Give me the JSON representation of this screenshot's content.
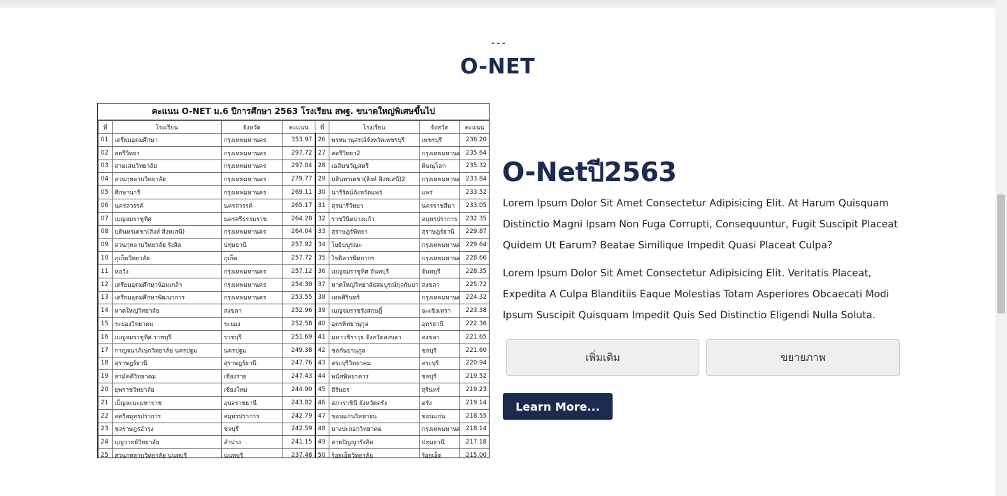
{
  "section": {
    "kicker": "---",
    "title": "O-NET"
  },
  "sheet": {
    "title": "คะแนน O-NET ม.6 ปีการศึกษา 2563 โรงเรียน สพฐ. ขนาดใหญ่พิเศษขึ้นไป",
    "headers": [
      "ที่",
      "โรงเรียน",
      "จังหวัด",
      "คะแนน",
      "ที่",
      "โรงเรียน",
      "จังหวัด",
      "คะแนน"
    ],
    "rows": [
      [
        "01",
        "เตรียมอุดมศึกษา",
        "กรุงเทพมหานคร",
        "353.97",
        "26",
        "พรหมานุสรณ์จังหวัดเพชรบุรี",
        "เพชรบุรี",
        "236.20"
      ],
      [
        "02",
        "สตรีวิทยา",
        "กรุงเทพมหานคร",
        "297.72",
        "27",
        "สตรีวิทยา2",
        "กรุงเทพมหานคร",
        "235.64"
      ],
      [
        "03",
        "สามเสนวิทยาลัย",
        "กรุงเทพมหานคร",
        "297.04",
        "28",
        "เฉลิมขวัญสตรี",
        "พิษณุโลก",
        "235.32"
      ],
      [
        "04",
        "สวนกุหลาบวิทยาลัย",
        "กรุงเทพมหานคร",
        "279.77",
        "29",
        "บดินทรเดชา(สิงห์ สิงหเสนี)2",
        "กรุงเทพมหานคร",
        "233.84"
      ],
      [
        "05",
        "ศึกษานารี",
        "กรุงเทพมหานคร",
        "269.11",
        "30",
        "นารีรัตน์จังหวัดแพร่",
        "แพร่",
        "233.52"
      ],
      [
        "06",
        "นครสวรรค์",
        "นครสวรรค์",
        "265.17",
        "31",
        "สุรนารีวิทยา",
        "นครราชสีมา",
        "233.05"
      ],
      [
        "07",
        "เบญจมราชูทิศ",
        "นครศรีธรรมราช",
        "264.28",
        "32",
        "ราชวินิตบางแก้ว",
        "สมุทรปราการ",
        "232.35"
      ],
      [
        "08",
        "บดินทรเดชา(สิงห์ สิงหเสนี)",
        "กรุงเทพมหานคร",
        "264.04",
        "33",
        "สุราษฎร์พิทยา",
        "สุราษฎร์ธานี",
        "229.87"
      ],
      [
        "09",
        "สวนกุหลาบวิทยาลัย รังสิต",
        "ปทุมธานี",
        "257.92",
        "34",
        "โยธินบูรณะ",
        "กรุงเทพมหานคร",
        "229.64"
      ],
      [
        "10",
        "ภูเก็ตวิทยาลัย",
        "ภูเก็ต",
        "257.72",
        "35",
        "โพธิสารพิทยากร",
        "กรุงเทพมหานคร",
        "228.66"
      ],
      [
        "11",
        "หอวัง",
        "กรุงเทพมหานคร",
        "257.12",
        "36",
        "เบญจมราชูทิศ จันทบุรี",
        "จันทบุรี",
        "228.35"
      ],
      [
        "12",
        "เตรียมอุดมศึกษาน้อมเกล้า",
        "กรุงเทพมหานคร",
        "254.30",
        "37",
        "หาดใหญ่วิทยาลัยสมบูรณ์กุลกันยา",
        "สงขลา",
        "225.72"
      ],
      [
        "13",
        "เตรียมอุดมศึกษาพัฒนาการ",
        "กรุงเทพมหานคร",
        "253.55",
        "38",
        "เทพศิรินทร์",
        "กรุงเทพมหานคร",
        "224.32"
      ],
      [
        "14",
        "หาดใหญ่วิทยาลัย",
        "สงขลา",
        "252.96",
        "39",
        "เบญจมราชรังสฤษฎิ์",
        "ฉะเชิงเทรา",
        "223.38"
      ],
      [
        "15",
        "ระยองวิทยาคม",
        "ระยอง",
        "252.58",
        "40",
        "อุดรพิทยานุกูล",
        "อุดรธานี",
        "222.36"
      ],
      [
        "16",
        "เบญจมราชูทิศ ราชบุรี",
        "ราชบุรี",
        "251.69",
        "41",
        "มหาวชิราวุธ จังหวัดสงขลา",
        "สงขลา",
        "221.65"
      ],
      [
        "17",
        "กาญจนาภิเษกวิทยาลัย นครปฐม",
        "นครปฐม",
        "249.38",
        "42",
        "ชลกันยานุกูล",
        "ชลบุรี",
        "221.60"
      ],
      [
        "18",
        "สุราษฎร์ธานี",
        "สุราษฎร์ธานี",
        "247.76",
        "43",
        "สระบุรีวิทยาคม",
        "สระบุรี",
        "220.94"
      ],
      [
        "19",
        "สามัคคีวิทยาคม",
        "เชียงราย",
        "247.43",
        "44",
        "พนัสพิทยาคาร",
        "ชลบุรี",
        "219.52"
      ],
      [
        "20",
        "ยุพราชวิทยาลัย",
        "เชียงใหม่",
        "244.90",
        "45",
        "สิรินธร",
        "สุรินทร์",
        "219.23"
      ],
      [
        "21",
        "เบ็ญจะมะมหาราช",
        "อุบลราชธานี",
        "243.82",
        "46",
        "สภาราชินี จังหวัดตรัง",
        "ตรัง",
        "219.14"
      ],
      [
        "22",
        "สตรีสมุทรปราการ",
        "สมุทรปราการ",
        "242.79",
        "47",
        "ขอนแก่นวิทยายน",
        "ขอนแก่น",
        "218.55"
      ],
      [
        "23",
        "ชลราษฎรอำรุง",
        "ชลบุรี",
        "242.59",
        "48",
        "บางปะกอกวิทยาคม",
        "กรุงเทพมหานคร",
        "218.14"
      ],
      [
        "24",
        "บุญวาทย์วิทยาลัย",
        "ลำปาง",
        "241.15",
        "49",
        "สายปัญญารังสิต",
        "ปทุมธานี",
        "217.18"
      ],
      [
        "25",
        "สวนกุหลาบวิทยาลัย นนทบุรี",
        "นนทบุรี",
        "237.48",
        "50",
        "ร้อยเอ็ดวิทยาลัย",
        "ร้อยเอ็ด",
        "215.00"
      ]
    ]
  },
  "content": {
    "title": "O-Netปี2563",
    "paragraph1": "Lorem Ipsum Dolor Sit Amet Consectetur Adipisicing Elit. At Harum Quisquam Distinctio Magni Ipsam Non Fuga Corrupti, Consequuntur, Fugit Suscipit Placeat Quidem Ut Earum? Beatae Similique Impedit Quasi Placeat Culpa?",
    "paragraph2": "Lorem Ipsum Dolor Sit Amet Consectetur Adipisicing Elit. Veritatis Placeat, Expedita A Culpa Blanditiis Eaque Molestias Totam Asperiores Obcaecati Modi Ipsum Suscipit Quisquam Impedit Quis Sed Distinctio Eligendi Nulla Soluta.",
    "more_label": "เพิ่มเติม",
    "zoom_label": "ขยายภาพ",
    "learn_label": "Learn More..."
  }
}
